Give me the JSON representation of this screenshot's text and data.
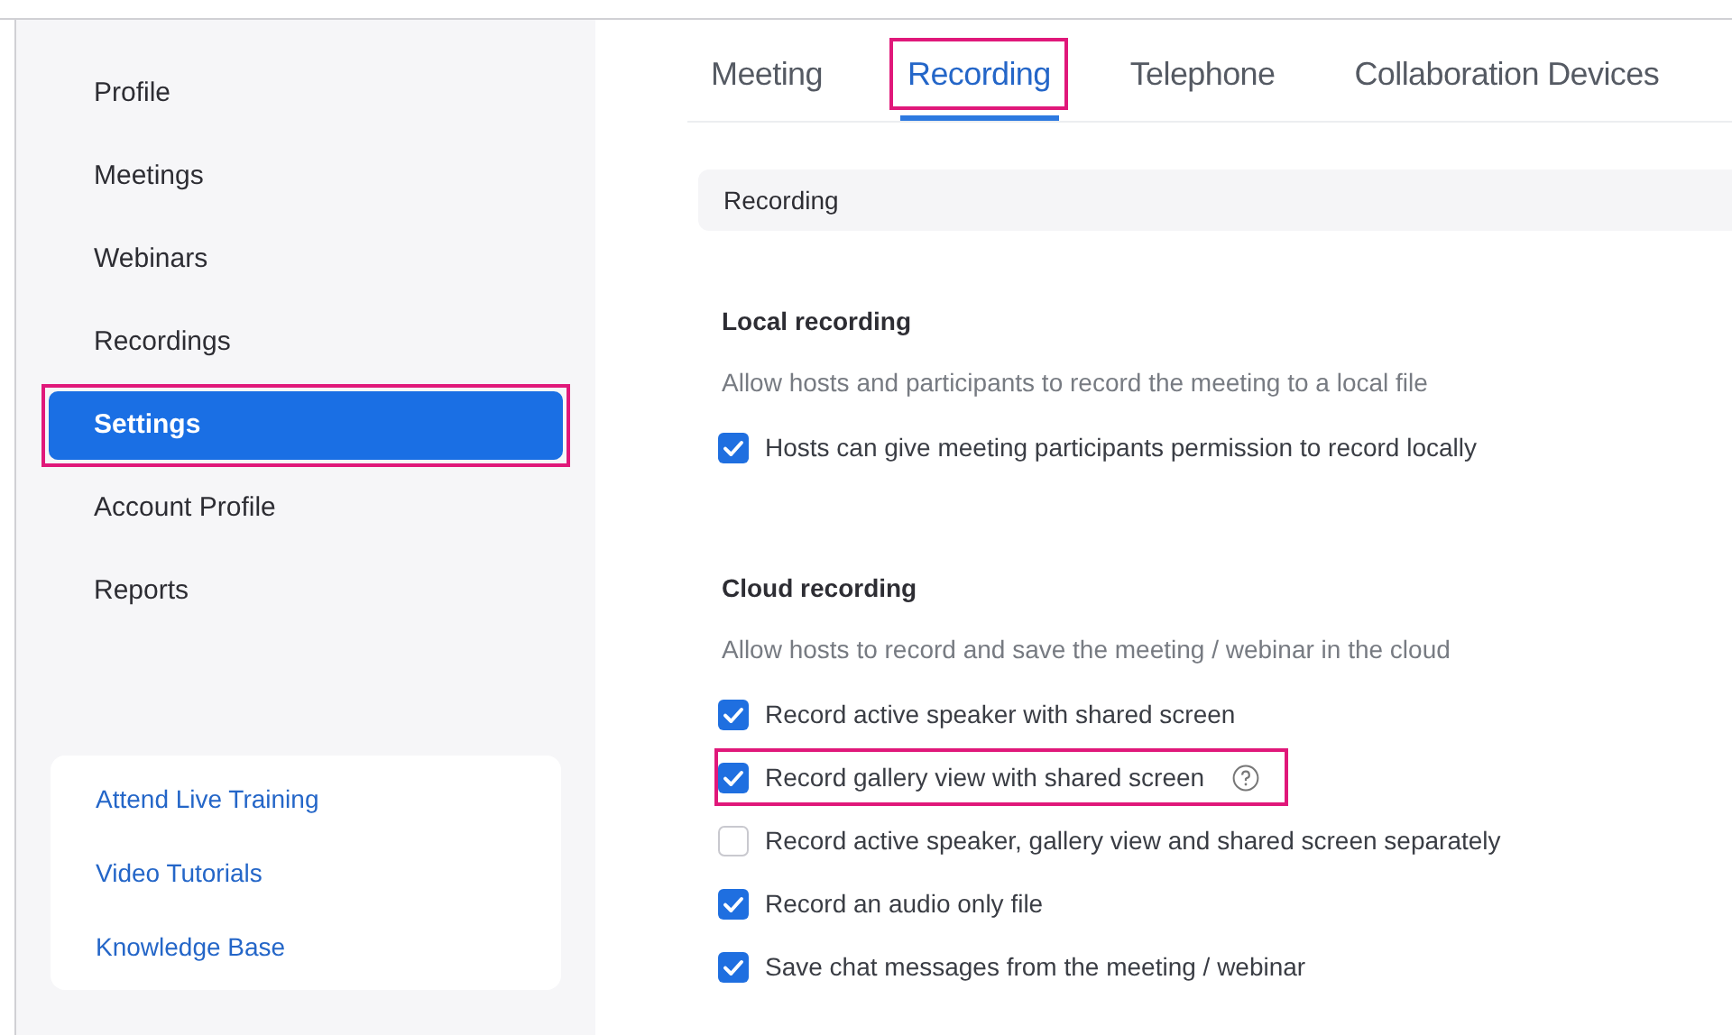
{
  "sidebar": {
    "items": [
      {
        "label": "Profile",
        "selected": false,
        "highlighted": false
      },
      {
        "label": "Meetings",
        "selected": false,
        "highlighted": false
      },
      {
        "label": "Webinars",
        "selected": false,
        "highlighted": false
      },
      {
        "label": "Recordings",
        "selected": false,
        "highlighted": false
      },
      {
        "label": "Settings",
        "selected": true,
        "highlighted": true
      },
      {
        "label": "Account Profile",
        "selected": false,
        "highlighted": false
      },
      {
        "label": "Reports",
        "selected": false,
        "highlighted": false
      }
    ],
    "links": [
      "Attend Live Training",
      "Video Tutorials",
      "Knowledge Base"
    ]
  },
  "tabs": [
    {
      "label": "Meeting",
      "selected": false,
      "highlighted": false
    },
    {
      "label": "Recording",
      "selected": true,
      "highlighted": true
    },
    {
      "label": "Telephone",
      "selected": false,
      "highlighted": false
    },
    {
      "label": "Collaboration Devices",
      "selected": false,
      "highlighted": false
    }
  ],
  "section_header": "Recording",
  "sections": [
    {
      "title": "Local recording",
      "description": "Allow hosts and participants to record the meeting to a local file",
      "options": [
        {
          "label": "Hosts can give meeting participants permission to record locally",
          "checked": true,
          "highlighted": false,
          "help": false
        }
      ]
    },
    {
      "title": "Cloud recording",
      "description": "Allow hosts to record and save the meeting / webinar in the cloud",
      "options": [
        {
          "label": "Record active speaker with shared screen",
          "checked": true,
          "highlighted": false,
          "help": false
        },
        {
          "label": "Record gallery view with shared screen",
          "checked": true,
          "highlighted": true,
          "help": true
        },
        {
          "label": "Record active speaker, gallery view and shared screen separately",
          "checked": false,
          "highlighted": false,
          "help": false
        },
        {
          "label": "Record an audio only file",
          "checked": true,
          "highlighted": false,
          "help": false
        },
        {
          "label": "Save chat messages from the meeting / webinar",
          "checked": true,
          "highlighted": false,
          "help": false
        }
      ]
    }
  ]
}
